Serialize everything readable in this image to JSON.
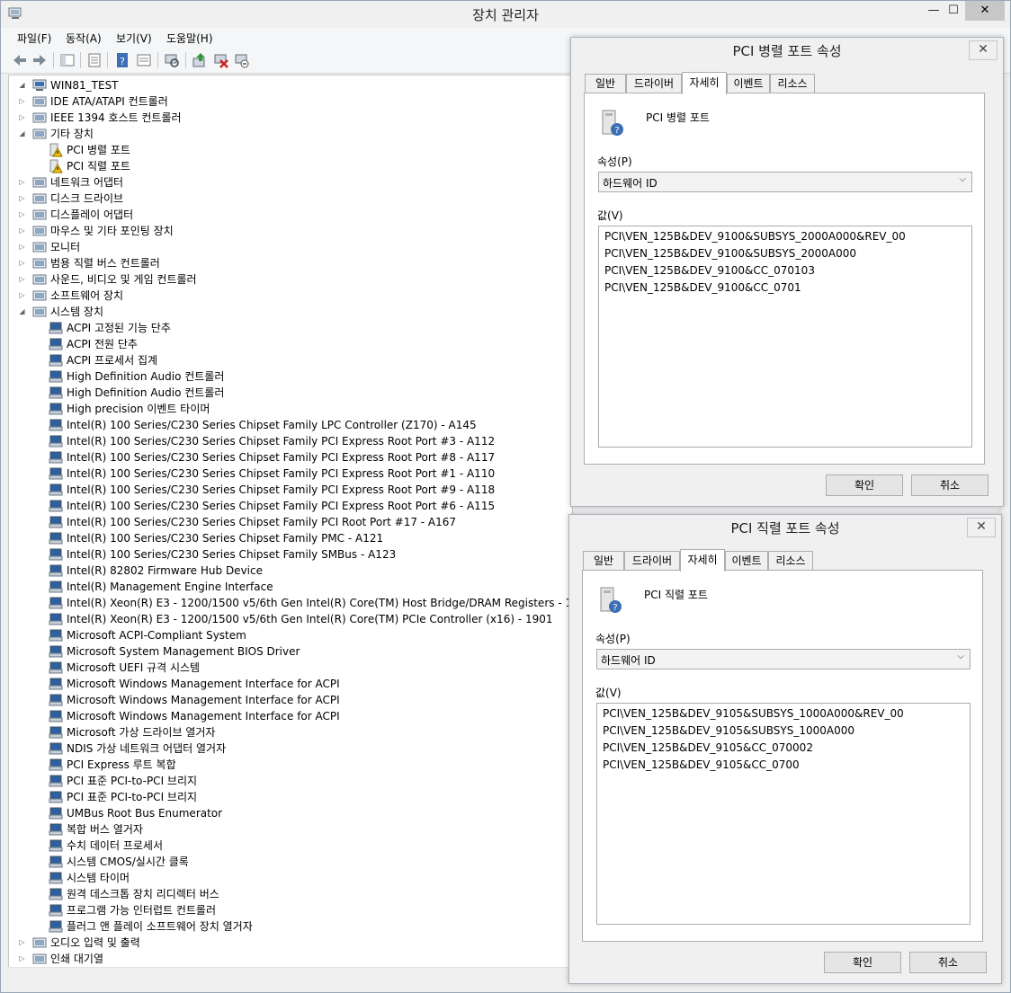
{
  "window": {
    "title": "장치 관리자",
    "controls": {
      "minimize": "—",
      "maximize": "☐",
      "close": "✕"
    }
  },
  "menu": [
    "파일(F)",
    "동작(A)",
    "보기(V)",
    "도움말(H)"
  ],
  "toolbar_icons": [
    "back-icon",
    "forward-icon",
    "show-hide-tree-icon",
    "properties-icon",
    "help-icon",
    "view-icon",
    "scan-hardware-icon",
    "update-driver-icon",
    "uninstall-icon",
    "disable-icon"
  ],
  "tree": {
    "root": "WIN81_TEST",
    "nodes": [
      {
        "label": "IDE ATA/ATAPI 컨트롤러",
        "level": 1,
        "expander": "collapsed"
      },
      {
        "label": "IEEE 1394 호스트 컨트롤러",
        "level": 1,
        "expander": "collapsed"
      },
      {
        "label": "기타 장치",
        "level": 1,
        "expander": "expanded"
      },
      {
        "label": "PCI 병렬 포트",
        "level": 2,
        "expander": "none",
        "warning": true
      },
      {
        "label": "PCI 직렬 포트",
        "level": 2,
        "expander": "none",
        "warning": true
      },
      {
        "label": "네트워크 어댑터",
        "level": 1,
        "expander": "collapsed"
      },
      {
        "label": "디스크 드라이브",
        "level": 1,
        "expander": "collapsed"
      },
      {
        "label": "디스플레이 어댑터",
        "level": 1,
        "expander": "collapsed"
      },
      {
        "label": "마우스 및 기타 포인팅 장치",
        "level": 1,
        "expander": "collapsed"
      },
      {
        "label": "모니터",
        "level": 1,
        "expander": "collapsed"
      },
      {
        "label": "범용 직렬 버스 컨트롤러",
        "level": 1,
        "expander": "collapsed"
      },
      {
        "label": "사운드, 비디오 및 게임 컨트롤러",
        "level": 1,
        "expander": "collapsed"
      },
      {
        "label": "소프트웨어 장치",
        "level": 1,
        "expander": "collapsed"
      },
      {
        "label": "시스템 장치",
        "level": 1,
        "expander": "expanded"
      },
      {
        "label": "ACPI 고정된 기능 단추",
        "level": 2,
        "expander": "none"
      },
      {
        "label": "ACPI 전원 단추",
        "level": 2,
        "expander": "none"
      },
      {
        "label": "ACPI 프로세서 집계",
        "level": 2,
        "expander": "none"
      },
      {
        "label": "High Definition Audio 컨트롤러",
        "level": 2,
        "expander": "none"
      },
      {
        "label": "High Definition Audio 컨트롤러",
        "level": 2,
        "expander": "none"
      },
      {
        "label": "High precision 이벤트 타이머",
        "level": 2,
        "expander": "none"
      },
      {
        "label": "Intel(R) 100 Series/C230 Series Chipset Family LPC Controller (Z170) - A145",
        "level": 2,
        "expander": "none"
      },
      {
        "label": "Intel(R) 100 Series/C230 Series Chipset Family PCI Express Root Port #3 - A112",
        "level": 2,
        "expander": "none"
      },
      {
        "label": "Intel(R) 100 Series/C230 Series Chipset Family PCI Express Root Port #8 - A117",
        "level": 2,
        "expander": "none"
      },
      {
        "label": "Intel(R) 100 Series/C230 Series Chipset Family PCI Express Root Port #1 - A110",
        "level": 2,
        "expander": "none"
      },
      {
        "label": "Intel(R) 100 Series/C230 Series Chipset Family PCI Express Root Port #9 - A118",
        "level": 2,
        "expander": "none"
      },
      {
        "label": "Intel(R) 100 Series/C230 Series Chipset Family PCI Express Root Port #6 - A115",
        "level": 2,
        "expander": "none"
      },
      {
        "label": "Intel(R) 100 Series/C230 Series Chipset Family PCI Root Port #17 - A167",
        "level": 2,
        "expander": "none"
      },
      {
        "label": "Intel(R) 100 Series/C230 Series Chipset Family PMC - A121",
        "level": 2,
        "expander": "none"
      },
      {
        "label": "Intel(R) 100 Series/C230 Series Chipset Family SMBus - A123",
        "level": 2,
        "expander": "none"
      },
      {
        "label": "Intel(R) 82802 Firmware Hub Device",
        "level": 2,
        "expander": "none"
      },
      {
        "label": "Intel(R) Management Engine Interface",
        "level": 2,
        "expander": "none"
      },
      {
        "label": "Intel(R) Xeon(R) E3 - 1200/1500 v5/6th Gen Intel(R) Core(TM) Host Bridge/DRAM Registers - 191F",
        "level": 2,
        "expander": "none"
      },
      {
        "label": "Intel(R) Xeon(R) E3 - 1200/1500 v5/6th Gen Intel(R) Core(TM) PCIe Controller (x16) - 1901",
        "level": 2,
        "expander": "none"
      },
      {
        "label": "Microsoft ACPI-Compliant System",
        "level": 2,
        "expander": "none"
      },
      {
        "label": "Microsoft System Management BIOS Driver",
        "level": 2,
        "expander": "none"
      },
      {
        "label": "Microsoft UEFI 규격 시스템",
        "level": 2,
        "expander": "none"
      },
      {
        "label": "Microsoft Windows Management Interface for ACPI",
        "level": 2,
        "expander": "none"
      },
      {
        "label": "Microsoft Windows Management Interface for ACPI",
        "level": 2,
        "expander": "none"
      },
      {
        "label": "Microsoft Windows Management Interface for ACPI",
        "level": 2,
        "expander": "none"
      },
      {
        "label": "Microsoft 가상 드라이브 열거자",
        "level": 2,
        "expander": "none"
      },
      {
        "label": "NDIS 가상 네트워크 어댑터 열거자",
        "level": 2,
        "expander": "none"
      },
      {
        "label": "PCI Express 루트 복합",
        "level": 2,
        "expander": "none"
      },
      {
        "label": "PCI 표준 PCI-to-PCI 브리지",
        "level": 2,
        "expander": "none"
      },
      {
        "label": "PCI 표준 PCI-to-PCI 브리지",
        "level": 2,
        "expander": "none"
      },
      {
        "label": "UMBus Root Bus Enumerator",
        "level": 2,
        "expander": "none"
      },
      {
        "label": "복합 버스 열거자",
        "level": 2,
        "expander": "none"
      },
      {
        "label": "수치 데이터 프로세서",
        "level": 2,
        "expander": "none"
      },
      {
        "label": "시스템 CMOS/실시간 클록",
        "level": 2,
        "expander": "none"
      },
      {
        "label": "시스템 타이머",
        "level": 2,
        "expander": "none"
      },
      {
        "label": "원격 데스크톱 장치 리디렉터 버스",
        "level": 2,
        "expander": "none"
      },
      {
        "label": "프로그램 가능 인터럽트 컨트롤러",
        "level": 2,
        "expander": "none"
      },
      {
        "label": "플러그 앤 플레이 소프트웨어 장치 열거자",
        "level": 2,
        "expander": "none"
      },
      {
        "label": "오디오 입력 및 출력",
        "level": 1,
        "expander": "collapsed"
      },
      {
        "label": "인쇄 대기열",
        "level": 1,
        "expander": "collapsed"
      }
    ]
  },
  "dialogs": [
    {
      "title": "PCI 병렬 포트 속성",
      "close": "✕",
      "tabs": [
        "일반",
        "드라이버",
        "자세히",
        "이벤트",
        "리소스"
      ],
      "active_tab": 2,
      "device_name": "PCI 병렬 포트",
      "property_label": "속성(P)",
      "property_value": "하드웨어 ID",
      "value_label": "값(V)",
      "values": [
        "PCI\\VEN_125B&DEV_9100&SUBSYS_2000A000&REV_00",
        "PCI\\VEN_125B&DEV_9100&SUBSYS_2000A000",
        "PCI\\VEN_125B&DEV_9100&CC_070103",
        "PCI\\VEN_125B&DEV_9100&CC_0701"
      ],
      "ok": "확인",
      "cancel": "취소"
    },
    {
      "title": "PCI 직렬 포트 속성",
      "close": "✕",
      "tabs": [
        "일반",
        "드라이버",
        "자세히",
        "이벤트",
        "리소스"
      ],
      "active_tab": 2,
      "device_name": "PCI 직렬 포트",
      "property_label": "속성(P)",
      "property_value": "하드웨어 ID",
      "value_label": "값(V)",
      "values": [
        "PCI\\VEN_125B&DEV_9105&SUBSYS_1000A000&REV_00",
        "PCI\\VEN_125B&DEV_9105&SUBSYS_1000A000",
        "PCI\\VEN_125B&DEV_9105&CC_070002",
        "PCI\\VEN_125B&DEV_9105&CC_0700"
      ],
      "ok": "확인",
      "cancel": "취소"
    }
  ]
}
